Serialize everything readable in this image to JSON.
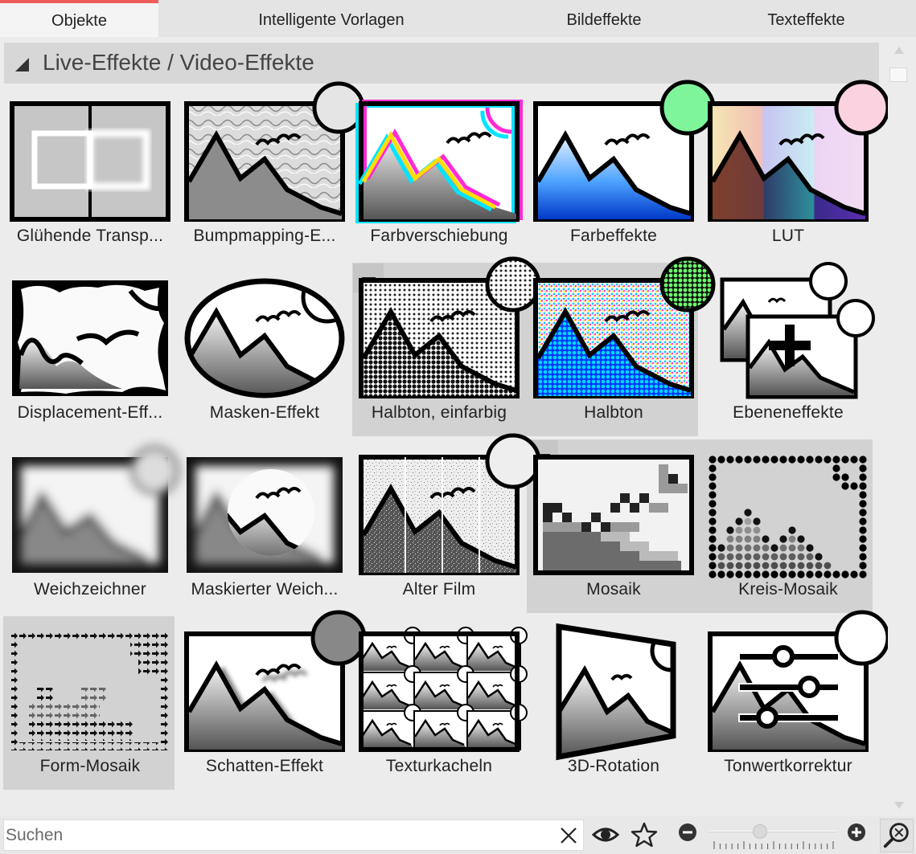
{
  "tabs": [
    {
      "label": "Objekte",
      "active": true
    },
    {
      "label": "Intelligente Vorlagen",
      "active": false
    },
    {
      "label": "Bildeffekte",
      "active": false
    },
    {
      "label": "Texteffekte",
      "active": false
    }
  ],
  "section": {
    "title": "Live-Effekte / Video-Effekte",
    "expanded": true
  },
  "colors": {
    "accent_tab": "#ef5b5b",
    "selection_bg": "#d2d2d2"
  },
  "effects": [
    {
      "label": "Glühende Transp...",
      "icon": "glowing-transparency-icon"
    },
    {
      "label": "Bumpmapping-E...",
      "icon": "bumpmapping-icon"
    },
    {
      "label": "Farbverschiebung",
      "icon": "color-shift-icon"
    },
    {
      "label": "Farbeffekte",
      "icon": "color-effects-icon"
    },
    {
      "label": "LUT",
      "icon": "lut-icon"
    },
    {
      "label": "Displacement-Eff...",
      "icon": "displacement-icon"
    },
    {
      "label": "Masken-Effekt",
      "icon": "mask-effect-icon"
    },
    {
      "label": "Halbton, einfarbig",
      "icon": "halftone-mono-icon"
    },
    {
      "label": "Halbton",
      "icon": "halftone-icon"
    },
    {
      "label": "Ebeneneffekte",
      "icon": "layer-effects-icon"
    },
    {
      "label": "Weichzeichner",
      "icon": "blur-icon"
    },
    {
      "label": "Maskierter Weich...",
      "icon": "masked-blur-icon"
    },
    {
      "label": "Alter Film",
      "icon": "old-film-icon"
    },
    {
      "label": "Mosaik",
      "icon": "mosaic-icon"
    },
    {
      "label": "Kreis-Mosaik",
      "icon": "circle-mosaic-icon"
    },
    {
      "label": "Form-Mosaik",
      "icon": "shape-mosaic-icon",
      "selected": true
    },
    {
      "label": "Schatten-Effekt",
      "icon": "shadow-effect-icon"
    },
    {
      "label": "Texturkacheln",
      "icon": "texture-tiles-icon"
    },
    {
      "label": "3D-Rotation",
      "icon": "3d-rotation-icon"
    },
    {
      "label": "Tonwertkorrektur",
      "icon": "tonal-correction-icon"
    }
  ],
  "search": {
    "placeholder": "Suchen",
    "value": ""
  },
  "toolbar": {
    "clear_icon": "close-icon",
    "eye_icon": "eye-icon",
    "star_icon": "star-icon",
    "zoom_out_icon": "zoom-out-icon",
    "zoom_in_icon": "zoom-in-icon",
    "fit_icon": "zoom-fit-icon",
    "zoom_level": 0.4
  }
}
